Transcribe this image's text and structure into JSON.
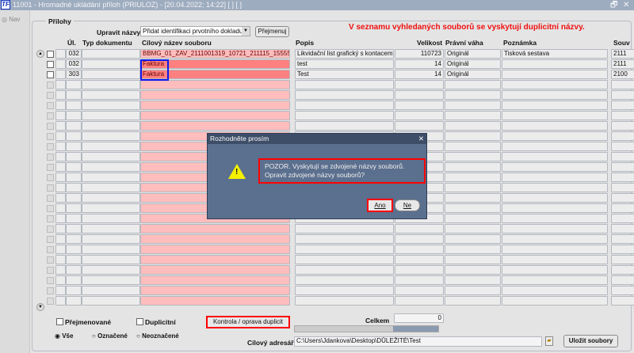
{
  "window": {
    "title": "11001 - Hromadné ukládání příloh (PRIULOZ) - [20.04.2022; 14:22]  [ ]  [ ]",
    "logo": "TF",
    "restore": "🗗",
    "close": "✕"
  },
  "nav": {
    "label": "Nav"
  },
  "section": {
    "title": "Přílohy",
    "rename_label": "Upravit názvy",
    "rename_select": "Přidat identifikaci prvotního dokladu",
    "rename_button": "Přejmenuj",
    "warning": "V seznamu vyhledaných souborů se vyskytují duplicitní názvy."
  },
  "columns": {
    "ul": "Úl.",
    "typ": "Typ dokumentu",
    "cil": "Cílový název souboru",
    "popis": "Popis",
    "velikost": "Velikost",
    "pravni": "Právní váha",
    "poznamka": "Poznámka",
    "souv": "Souv"
  },
  "rows": [
    {
      "ul": "032",
      "typ": "",
      "cil": "BBMG_01_ZAV_2111001319_10721_211115_155555_",
      "popis": "Likvidační list grafický s kontacemi",
      "velikost": "110723",
      "pravni": "Originál",
      "poznamka": "Tisková sestava",
      "souv": "2111"
    },
    {
      "ul": "032",
      "typ": "",
      "cil": "Faktura",
      "popis": "test",
      "velikost": "14",
      "pravni": "Originál",
      "poznamka": "",
      "souv": "2111"
    },
    {
      "ul": "303",
      "typ": "",
      "cil": "Faktura",
      "popis": "Test",
      "velikost": "14",
      "pravni": "Originál",
      "poznamka": "",
      "souv": "2100"
    }
  ],
  "dialog": {
    "title": "Rozhodněte prosím",
    "message": "POZOR. Vyskytují se zdvojené názvy souborů. Opravit zdvojené názvy souborů?",
    "yes": "Ano",
    "no": "Ne"
  },
  "footer": {
    "renamed": "Přejmenované",
    "duplicate": "Duplicitní",
    "check_button": "Kontrola / oprava duplicit",
    "total_label": "Celkem",
    "total_value": "0",
    "radio_all": "Vše",
    "radio_marked": "Označené",
    "radio_unmarked": "Neoznačené",
    "target_dir_label": "Cílový adresář",
    "target_dir": "C:\\Users\\Jdankova\\Desktop\\DŮLEŽITÉ\\Test",
    "save_button": "Uložit soubory"
  }
}
